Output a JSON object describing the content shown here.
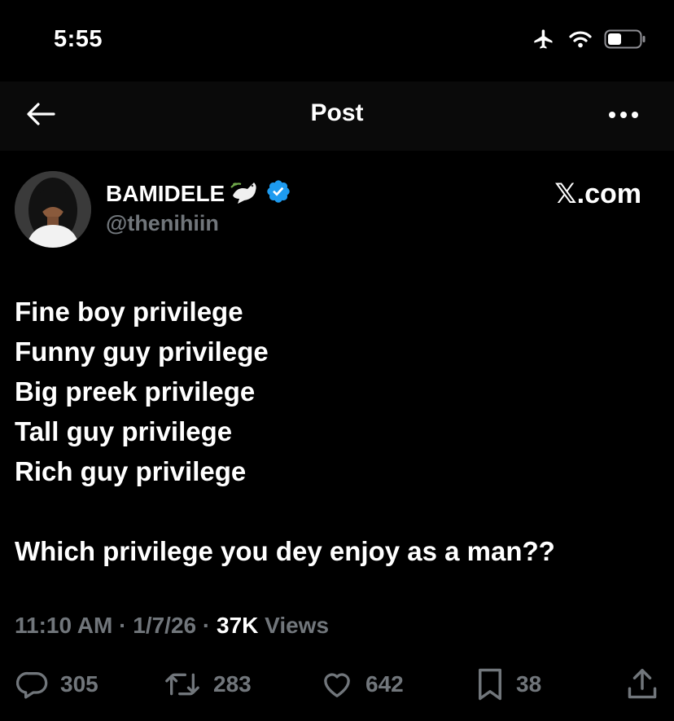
{
  "status_bar": {
    "time": "5:55",
    "icons": [
      "airplane-icon",
      "wifi-icon",
      "battery-icon"
    ]
  },
  "nav": {
    "title": "Post",
    "back_icon": "back-arrow-icon",
    "more_icon": "more-icon"
  },
  "post": {
    "display_name": "BAMIDELE",
    "name_emoji": "🕊️",
    "verified": true,
    "handle": "@thenihiin",
    "source_badge": "𝕏.com",
    "lines": [
      "Fine boy privilege",
      "Funny guy privilege",
      "Big preek privilege",
      "Tall guy privilege",
      "Rich guy privilege",
      "",
      "Which privilege you dey enjoy as a man??"
    ],
    "time": "11:10 AM",
    "separator": "·",
    "date": "1/7/26",
    "views_count": "37K",
    "views_label": "Views"
  },
  "actions": {
    "replies": "305",
    "reposts": "283",
    "likes": "642",
    "bookmarks": "38"
  },
  "colors": {
    "background": "#000000",
    "text": "#ffffff",
    "muted": "#71767b",
    "verified": "#1d9bf0"
  }
}
